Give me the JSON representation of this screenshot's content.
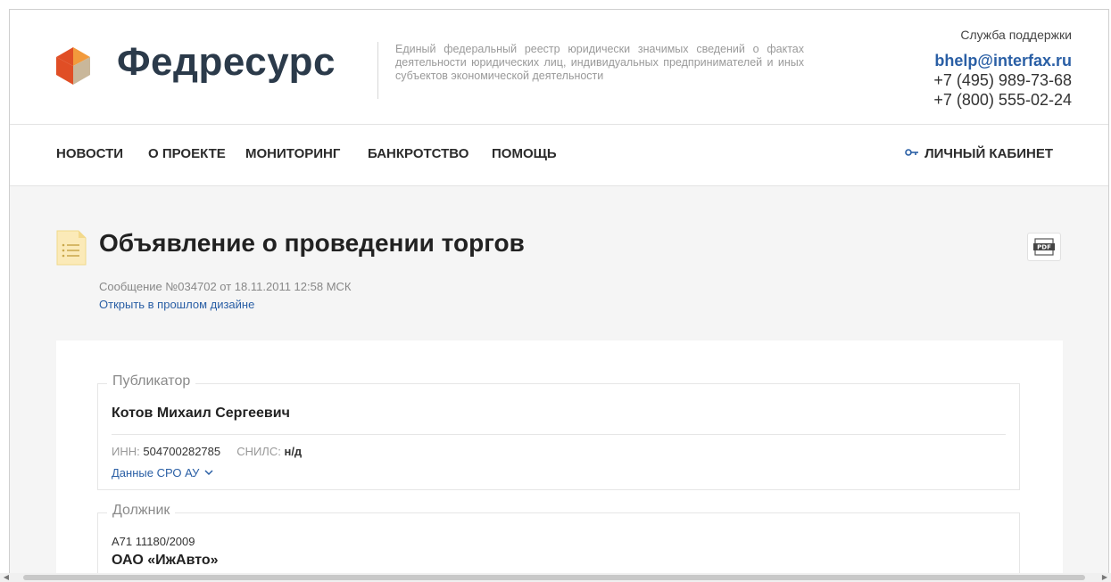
{
  "header": {
    "logo_text": "Федресурс",
    "tagline": "Единый федеральный реестр юридически значимых сведений о фактах деятельности юридических лиц, индивидуальных предпринимателей и иных субъектов экономической деятельности",
    "support_title": "Служба поддержки",
    "support_email": "bhelp@interfax.ru",
    "phone1": "+7 (495) 989-73-68",
    "phone2": "+7 (800) 555-02-24",
    "logo_colors": [
      "#e04e25",
      "#f29a3c",
      "#c9b79a"
    ]
  },
  "nav": {
    "items": [
      "НОВОСТИ",
      "О ПРОЕКТЕ",
      "МОНИТОРИНГ",
      "БАНКРОТСТВО",
      "ПОМОЩЬ"
    ],
    "cabinet": "ЛИЧНЫЙ КАБИНЕТ",
    "cabinet_icon": "key-icon"
  },
  "page": {
    "title": "Объявление о проведении торгов",
    "meta": "Сообщение №034702 от 18.11.2011 12:58 МСК",
    "old_design_link": "Открыть в прошлом дизайне",
    "pdf_label": "PDF"
  },
  "publisher": {
    "legend": "Публикатор",
    "name": "Котов Михаил Сергеевич",
    "inn_label": "ИНН:",
    "inn_value": "504700282785",
    "snils_label": "СНИЛС:",
    "snils_value": "н/д",
    "sro_link": "Данные СРО АУ"
  },
  "debtor": {
    "legend": "Должник",
    "case_number": "А71 11180/2009",
    "name": "ОАО «ИжАвто»"
  },
  "colors": {
    "accent_link": "#2a5fa5",
    "background": "#f5f5f5"
  }
}
